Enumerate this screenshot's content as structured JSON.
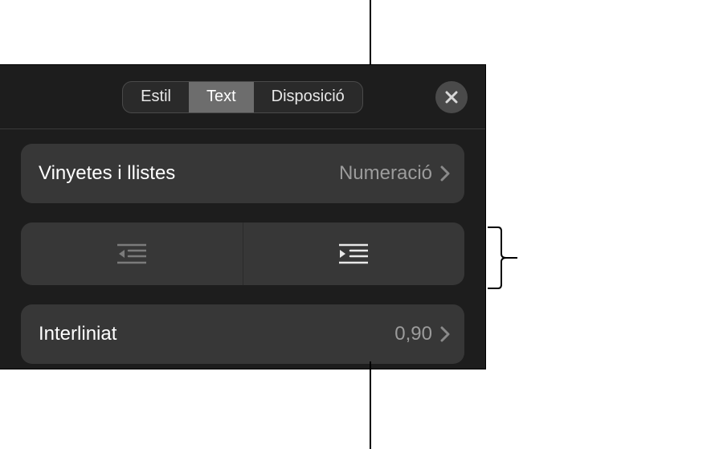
{
  "tabs": {
    "items": [
      "Estil",
      "Text",
      "Disposició"
    ],
    "active_index": 1
  },
  "rows": {
    "bullets": {
      "label": "Vinyetes i llistes",
      "value": "Numeració"
    },
    "indent": {
      "outdent_icon": "outdent-icon",
      "indent_icon": "indent-icon"
    },
    "linespacing": {
      "label": "Interliniat",
      "value": "0,90"
    }
  },
  "icons": {
    "close": "close-icon",
    "chevron": "chevron-right-icon"
  }
}
